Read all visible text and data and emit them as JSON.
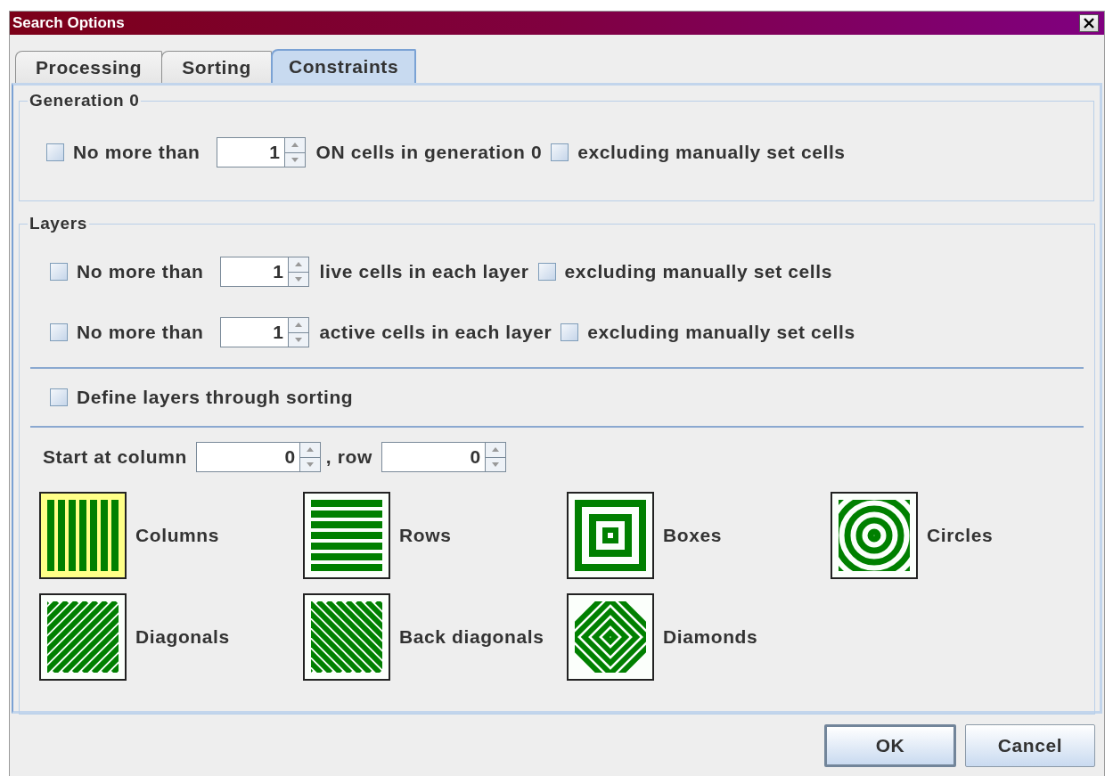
{
  "window": {
    "title": "Search Options"
  },
  "tabs": [
    {
      "label": "Processing",
      "selected": false
    },
    {
      "label": "Sorting",
      "selected": false
    },
    {
      "label": "Constraints",
      "selected": true
    }
  ],
  "generation_0": {
    "title": "Generation 0",
    "rows": [
      {
        "checked": false,
        "label": "No more than",
        "value": "1",
        "suffix": "ON cells in generation 0",
        "exclude_checked": false,
        "exclude_label": "excluding manually set cells"
      }
    ]
  },
  "layers": {
    "title": "Layers",
    "rows": [
      {
        "checked": false,
        "label": "No more than",
        "value": "1",
        "suffix": "live cells in each layer",
        "exclude_checked": false,
        "exclude_label": "excluding manually set cells"
      },
      {
        "checked": false,
        "label": "No more than",
        "value": "1",
        "suffix": "active cells in each layer",
        "exclude_checked": false,
        "exclude_label": "excluding manually set cells"
      }
    ],
    "define_through_sorting": {
      "checked": false,
      "label": "Define layers through sorting"
    },
    "start_label": "Start at column",
    "column_value": "0",
    "row_label": ", row",
    "row_value": "0",
    "patterns": [
      {
        "kind": "columns",
        "label": "Columns",
        "selected": true
      },
      {
        "kind": "rows",
        "label": "Rows",
        "selected": false
      },
      {
        "kind": "boxes",
        "label": "Boxes",
        "selected": false
      },
      {
        "kind": "circles",
        "label": "Circles",
        "selected": false
      },
      {
        "kind": "diagonals",
        "label": "Diagonals",
        "selected": false
      },
      {
        "kind": "back_diagonals",
        "label": "Back diagonals",
        "selected": false
      },
      {
        "kind": "diamonds",
        "label": "Diamonds",
        "selected": false
      }
    ]
  },
  "buttons": [
    {
      "label": "OK",
      "default": true
    },
    {
      "label": "Cancel",
      "default": false
    }
  ]
}
